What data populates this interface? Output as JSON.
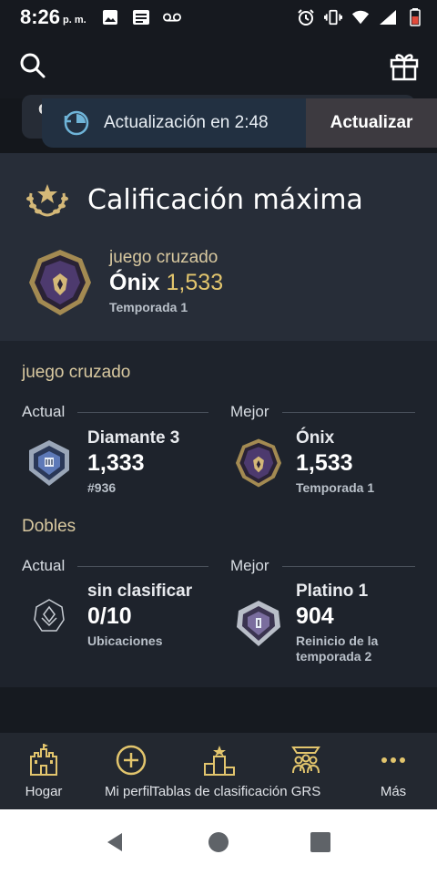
{
  "status_bar": {
    "time": "8:26",
    "ampm": "p. m.",
    "icons_left": [
      "image-icon",
      "news-icon",
      "voicemail-icon"
    ],
    "icons_right": [
      "alarm-icon",
      "vibrate-icon",
      "wifi-icon",
      "signal-icon",
      "battery-icon"
    ]
  },
  "app_bar": {
    "icons": [
      "search-icon",
      "gift-icon"
    ]
  },
  "behind": {
    "text": "clasificado"
  },
  "update_banner": {
    "text": "Actualización en 2:48",
    "button": "Actualizar",
    "icon": "timer-refresh-icon"
  },
  "peak": {
    "title": "Calificación máxima",
    "playlist": "juego cruzado",
    "rank": "Ónix",
    "rating": "1,533",
    "season": "Temporada 1"
  },
  "playlists": [
    {
      "name": "juego cruzado",
      "current": {
        "label": "Actual",
        "rank": "Diamante 3",
        "rating": "1,333",
        "sub": "#936"
      },
      "best": {
        "label": "Mejor",
        "rank": "Ónix",
        "rating": "1,533",
        "sub": "Temporada 1"
      }
    },
    {
      "name": "Dobles",
      "current": {
        "label": "Actual",
        "rank": "sin clasificar",
        "rating": "0/10",
        "sub": "Ubicaciones"
      },
      "best": {
        "label": "Mejor",
        "rank": "Platino 1",
        "rating": "904",
        "sub": "Reinicio de la temporada 2"
      }
    }
  ],
  "bottom_nav": [
    {
      "label": "Hogar",
      "icon": "castle-icon"
    },
    {
      "label": "Mi perfil",
      "icon": "plus-circle-icon"
    },
    {
      "label": "Tablas de clasificación",
      "icon": "podium-icon"
    },
    {
      "label": "GRS",
      "icon": "group-icon"
    },
    {
      "label": "Más",
      "icon": "more-icon"
    }
  ],
  "colors": {
    "gold": "#e2c56d",
    "accent_text": "#d9c9a0",
    "banner": "#223041",
    "card": "#272d38"
  }
}
